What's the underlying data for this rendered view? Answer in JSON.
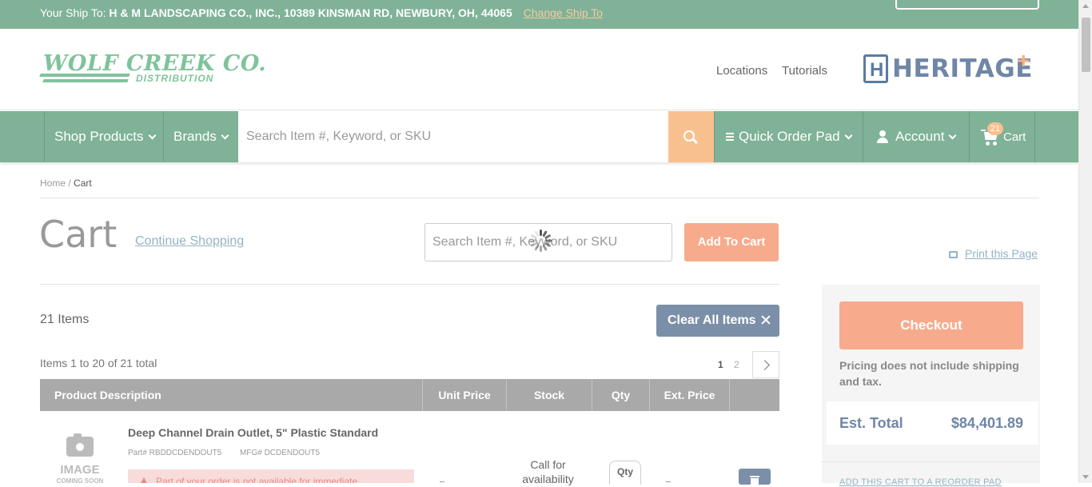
{
  "topbar": {
    "ship_label": "Your Ship To:",
    "ship_address": "H & M LANDSCAPING CO., INC., 10389 KINSMAN RD, NEWBURY, OH, 44065",
    "change_link": "Change Ship To"
  },
  "header": {
    "logo_main": "WOLF CREEK CO.",
    "logo_sub": "DISTRIBUTION",
    "links": [
      "Locations",
      "Tutorials"
    ],
    "partner_logo": "HERITAGE",
    "partner_logo_mark": "H",
    "partner_logo_plus": "+"
  },
  "nav": {
    "shop_products": "Shop Products",
    "brands": "Brands",
    "search_placeholder": "Search Item #, Keyword, or SKU",
    "quick_order": "Quick Order Pad",
    "account": "Account",
    "cart": "Cart",
    "cart_count": "21"
  },
  "breadcrumb": {
    "home": "Home",
    "separator": "/",
    "current": "Cart"
  },
  "cart": {
    "title": "Cart",
    "continue_shopping": "Continue Shopping",
    "search_placeholder": "Search Item #, Keyword, or SKU",
    "add_to_cart": "Add To Cart",
    "print_link": "Print this Page",
    "items_count": "21 Items",
    "clear_all": "Clear All Items",
    "range_text": "Items 1 to 20 of 21 total",
    "pages": [
      "1",
      "2"
    ]
  },
  "table": {
    "headers": [
      "Product Description",
      "Unit Price",
      "Stock",
      "Qty",
      "Ext. Price"
    ],
    "rows": [
      {
        "image_text_1": "IMAGE",
        "image_text_2": "COMING SOON",
        "name": "Deep Channel Drain Outlet, 5\" Plastic Standard",
        "part": "Part# RBDDCDENDOUT5",
        "mfg": "MFG# DCDENDOUT5",
        "warning": "Part of your order is not available for immediate",
        "stock": "Call for availability",
        "qty_label": "Qty"
      }
    ]
  },
  "summary": {
    "checkout": "Checkout",
    "pricing_note": "Pricing does not include shipping and tax.",
    "est_total_label": "Est. Total",
    "est_total_value": "$84,401.89",
    "reorder_link": "ADD THIS CART TO A REORDER PAD"
  },
  "colors": {
    "brand_green": "#7fb296",
    "accent_orange": "#f7ab8c",
    "slate_blue": "#7b8fa8"
  }
}
